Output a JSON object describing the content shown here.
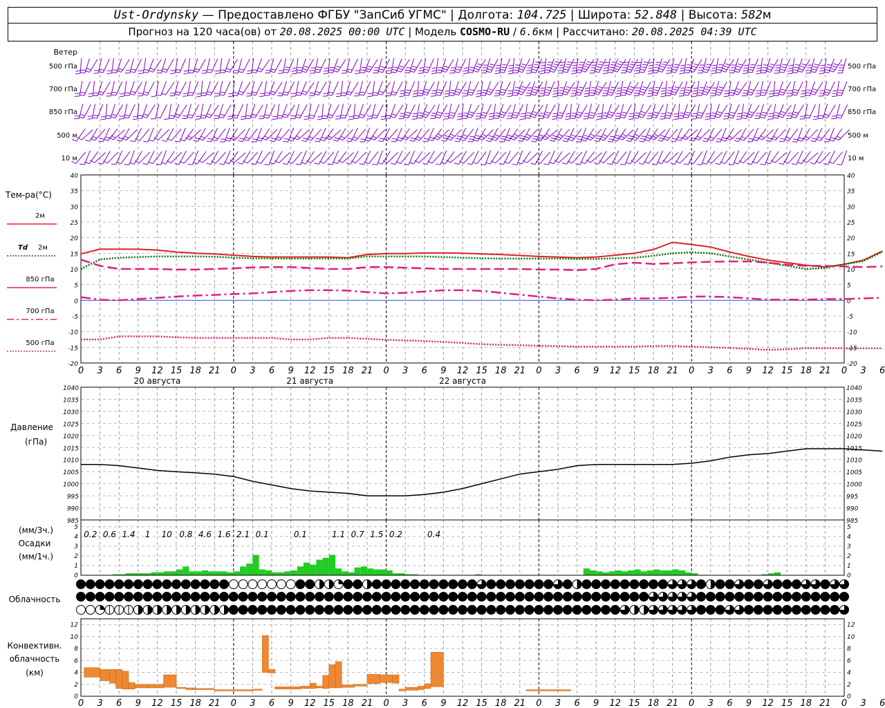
{
  "header": {
    "station": "Ust-Ordynsky",
    "provider": "Предоставлено ФГБУ \"ЗапСиб УГМС\"",
    "lon_label": "Долгота:",
    "lon": "104.725",
    "lat_label": "Широта:",
    "lat": "52.848",
    "alt_label": "Высота:",
    "alt": "582",
    "alt_unit": "м",
    "forecast_prefix": "Прогноз на 120 часа(ов) от",
    "forecast_from": "20.08.2025 00:00 UTC",
    "model_label": "Модель",
    "model": "COSMO-RU",
    "model_res": "6.6",
    "model_res_unit": "км",
    "calc_label": "Рассчитано:",
    "calc_time": "20.08.2025 04:39 UTC"
  },
  "chart_data": [
    {
      "id": "wind",
      "type": "wind_barbs",
      "title": "Ветер",
      "levels": [
        "500 гПа",
        "700 гПа",
        "850 гПа",
        "500 м",
        "10  м"
      ],
      "barb_color": "#8000c0",
      "speed_ms": [
        [
          12,
          11,
          10,
          9,
          8,
          8,
          9,
          10,
          11,
          12,
          12,
          13,
          14,
          13,
          12,
          13,
          14,
          15,
          16,
          15,
          14,
          18,
          20,
          22,
          23,
          24,
          25,
          25,
          24,
          24,
          23,
          22,
          22,
          22,
          22,
          22,
          22,
          22,
          22,
          22,
          20,
          18,
          16
        ],
        [
          8,
          9,
          9,
          8,
          7,
          8,
          9,
          10,
          11,
          12,
          12,
          11,
          10,
          10,
          10,
          11,
          12,
          13,
          14,
          15,
          15,
          16,
          17,
          18,
          19,
          20,
          20,
          20,
          20,
          19,
          19,
          18,
          18,
          18,
          17,
          16,
          15,
          14,
          14,
          14,
          13,
          12,
          12
        ],
        [
          8,
          9,
          9,
          8,
          7,
          8,
          9,
          10,
          10,
          11,
          11,
          10,
          10,
          10,
          11,
          12,
          12,
          13,
          13,
          14,
          14,
          15,
          16,
          16,
          17,
          17,
          17,
          16,
          16,
          15,
          15,
          15,
          15,
          14,
          14,
          14,
          13,
          13,
          12,
          12,
          12,
          11,
          11
        ],
        [
          7,
          8,
          8,
          7,
          7,
          7,
          8,
          9,
          10,
          10,
          10,
          10,
          10,
          10,
          11,
          11,
          12,
          12,
          12,
          13,
          13,
          14,
          14,
          14,
          15,
          15,
          14,
          14,
          14,
          13,
          13,
          12,
          12,
          12,
          12,
          11,
          11,
          11,
          10,
          10,
          10,
          9,
          9
        ],
        [
          3,
          3,
          3,
          3,
          3,
          3,
          3,
          4,
          5,
          5,
          5,
          4,
          4,
          4,
          5,
          5,
          5,
          5,
          5,
          5,
          5,
          5,
          5,
          5,
          5,
          5,
          5,
          5,
          4,
          4,
          4,
          4,
          4,
          3,
          3,
          3,
          3,
          3,
          3,
          3,
          3,
          3,
          3
        ]
      ]
    },
    {
      "id": "temperature",
      "type": "line",
      "ylabel": "Тем-ра(°C)",
      "ylim": [
        -20,
        40
      ],
      "x_hours_step": 3,
      "series": [
        {
          "name": "2м",
          "style": "solid",
          "color": "#e02020",
          "values": [
            14.8,
            16.3,
            16.3,
            16.3,
            16.0,
            15.4,
            15.0,
            14.8,
            14.4,
            14.0,
            13.8,
            13.8,
            13.8,
            13.8,
            13.6,
            14.6,
            14.9,
            14.9,
            15.1,
            15.1,
            15.0,
            14.8,
            14.6,
            14.3,
            14.0,
            13.8,
            13.6,
            13.8,
            14.4,
            15.0,
            16.2,
            18.5,
            17.8,
            17.0,
            15.4,
            14.0,
            12.8,
            12.0,
            11.2,
            10.6,
            11.5,
            12.8,
            15.7
          ]
        },
        {
          "name": "Td 2м",
          "style": "dotted",
          "color": "#007000",
          "values": [
            10.0,
            13.0,
            13.6,
            13.8,
            14.0,
            14.0,
            14.0,
            13.9,
            13.6,
            13.4,
            13.3,
            13.3,
            13.3,
            13.3,
            13.3,
            14.0,
            14.0,
            14.0,
            14.0,
            13.8,
            13.6,
            13.4,
            13.3,
            13.3,
            13.3,
            13.3,
            13.2,
            13.2,
            13.4,
            13.6,
            14.2,
            15.0,
            15.3,
            15.0,
            14.0,
            13.0,
            12.0,
            11.0,
            10.0,
            10.3,
            11.5,
            12.5,
            15.4
          ]
        },
        {
          "name": "850 гПа",
          "style": "dashed",
          "color": "#e0207a",
          "values": [
            13.0,
            11.0,
            10.0,
            10.0,
            10.0,
            9.8,
            9.8,
            10.0,
            10.2,
            10.5,
            10.6,
            10.6,
            10.3,
            10.0,
            10.0,
            10.6,
            10.6,
            10.4,
            10.2,
            10.0,
            10.0,
            10.0,
            10.0,
            10.0,
            9.8,
            9.8,
            9.6,
            10.0,
            11.5,
            12.0,
            11.6,
            11.8,
            12.1,
            12.3,
            12.4,
            12.4,
            12.0,
            11.4,
            11.0,
            11.0,
            10.8,
            10.6,
            10.8
          ]
        },
        {
          "name": "700 гПа",
          "style": "dashdot",
          "color": "#e0207a",
          "values": [
            1.0,
            0.2,
            0.0,
            0.4,
            0.8,
            1.2,
            1.5,
            1.7,
            2.0,
            2.2,
            2.6,
            3.0,
            3.2,
            3.2,
            3.1,
            2.6,
            2.2,
            2.4,
            2.8,
            3.2,
            3.2,
            3.0,
            2.4,
            1.8,
            1.2,
            0.6,
            0.2,
            0.0,
            0.2,
            0.6,
            0.6,
            0.8,
            1.2,
            1.2,
            1.0,
            0.6,
            0.2,
            0.2,
            0.2,
            0.4,
            0.4,
            0.6,
            0.8
          ]
        },
        {
          "name": "500 гПа",
          "style": "dotted",
          "color": "#e0207a",
          "values": [
            -12.5,
            -12.5,
            -11.5,
            -11.5,
            -11.5,
            -11.8,
            -12.0,
            -12.0,
            -12.0,
            -12.0,
            -12.0,
            -12.5,
            -12.5,
            -12.0,
            -12.0,
            -12.3,
            -12.6,
            -12.8,
            -13.0,
            -13.3,
            -13.6,
            -14.0,
            -14.2,
            -14.3,
            -14.5,
            -14.6,
            -14.8,
            -14.8,
            -14.8,
            -14.8,
            -14.6,
            -14.6,
            -14.8,
            -15.0,
            -15.2,
            -15.5,
            -15.8,
            -15.6,
            -15.3,
            -15.3,
            -15.3,
            -15.3,
            -15.3
          ]
        }
      ]
    },
    {
      "id": "pressure",
      "type": "line",
      "ylabel": "Давление",
      "yunit": "(гПа)",
      "ylim": [
        985,
        1040
      ],
      "series": [
        {
          "name": "",
          "values": [
            1008.0,
            1008.0,
            1007.5,
            1006.5,
            1005.5,
            1005.0,
            1004.5,
            1004.0,
            1003.0,
            1001.0,
            999.5,
            998.0,
            997.0,
            996.5,
            996.0,
            995.0,
            995.0,
            995.0,
            995.5,
            996.5,
            998.0,
            1000.0,
            1002.0,
            1004.0,
            1005.0,
            1006.0,
            1007.5,
            1008.0,
            1008.0,
            1008.0,
            1008.0,
            1008.0,
            1008.5,
            1009.5,
            1011.0,
            1012.0,
            1012.5,
            1013.5,
            1014.5,
            1014.5,
            1014.5,
            1014.0,
            1013.5
          ]
        }
      ]
    },
    {
      "id": "precip",
      "type": "bar",
      "ylabel": "(мм/3ч.)",
      "title": "Осадки",
      "yunit2": "(мм/1ч.)",
      "ylim": [
        0,
        5
      ],
      "bar_color": "#22cc22",
      "hourly_mm": [
        0,
        0,
        0,
        0,
        0,
        0.1,
        0.1,
        0.2,
        0.2,
        0.2,
        0.2,
        0.3,
        0.3,
        0.4,
        0.4,
        0.6,
        0.9,
        0.4,
        0.4,
        0.5,
        0.4,
        0.4,
        0.4,
        0.3,
        0.4,
        0.9,
        1.2,
        2.1,
        0.6,
        0.5,
        0.3,
        0.3,
        0.4,
        0.5,
        0.9,
        1.3,
        1.1,
        1.6,
        1.8,
        2.1,
        0.7,
        0.4,
        0.3,
        0.8,
        0.9,
        0.7,
        0.6,
        0.6,
        0.5,
        0.2,
        0.2,
        0.1,
        0.1,
        0,
        0,
        0,
        0,
        0,
        0,
        0,
        0,
        0,
        0.1,
        0,
        0,
        0,
        0,
        0,
        0,
        0,
        0,
        0,
        0,
        0,
        0,
        0,
        0,
        0,
        0,
        0.7,
        0.5,
        0.4,
        0.3,
        0.4,
        0.5,
        0.4,
        0.5,
        0.6,
        0.4,
        0.5,
        0.6,
        0.5,
        0.5,
        0.6,
        0.5,
        0.3,
        0.2,
        0,
        0,
        0,
        0,
        0,
        0,
        0,
        0,
        0,
        0,
        0.1,
        0.2,
        0.3,
        0,
        0,
        0,
        0,
        0,
        0,
        0,
        0,
        0,
        0,
        0
      ],
      "sums_3h": [
        {
          "hour": 1.5,
          "value": "0.2"
        },
        {
          "hour": 4.5,
          "value": "0.6"
        },
        {
          "hour": 7.5,
          "value": "1.4"
        },
        {
          "hour": 10.5,
          "value": "1"
        },
        {
          "hour": 13.5,
          "value": "10"
        },
        {
          "hour": 16.5,
          "value": "0.8"
        },
        {
          "hour": 19.5,
          "value": "4.6"
        },
        {
          "hour": 22.5,
          "value": "1.6"
        },
        {
          "hour": 25.5,
          "value": "2.1"
        },
        {
          "hour": 28.5,
          "value": "0.1"
        },
        {
          "hour": 34.5,
          "value": "0.1"
        },
        {
          "hour": 40.5,
          "value": "1.1"
        },
        {
          "hour": 43.5,
          "value": "0.7"
        },
        {
          "hour": 46.5,
          "value": "1.5"
        },
        {
          "hour": 49.5,
          "value": "0.2"
        },
        {
          "hour": 55.5,
          "value": "0.4"
        }
      ]
    },
    {
      "id": "clouds",
      "type": "cloud_symbols",
      "title": "Облачность",
      "rows": [
        "8888888888888888000000088442884888888888886888888868488888888866684886886888668666861800000000000000000000000000000000000000000000000",
        "8888888888888888888888888888888888888888888888888888888888886666688888888888888888888888888880004400800000000000000000000000000000000000",
        "0023334444444444888888888888888888888888888888888888888886446666688866888888888860000000000888888888888888888888888888888888888888888888"
      ]
    },
    {
      "id": "convective",
      "type": "bar",
      "title": "Конвективн. облачность",
      "yunit": "(км)",
      "ylim": [
        0,
        13
      ],
      "bar_color": "#ee8833",
      "bars": [
        {
          "from": 0.5,
          "to": 3,
          "bottom": 3.2,
          "top": 4.8
        },
        {
          "from": 3,
          "to": 4.5,
          "bottom": 2.6,
          "top": 4.5
        },
        {
          "from": 4.5,
          "to": 5.5,
          "bottom": 2.2,
          "top": 4.5
        },
        {
          "from": 5.5,
          "to": 6.5,
          "bottom": 1.3,
          "top": 4.5
        },
        {
          "from": 6.5,
          "to": 7.5,
          "bottom": 1.2,
          "top": 4.2
        },
        {
          "from": 7.5,
          "to": 8.5,
          "bottom": 1.2,
          "top": 2.3
        },
        {
          "from": 8.5,
          "to": 10.5,
          "bottom": 1.4,
          "top": 2.0
        },
        {
          "from": 10.5,
          "to": 13,
          "bottom": 1.4,
          "top": 2.0
        },
        {
          "from": 13,
          "to": 15,
          "bottom": 1.5,
          "top": 3.6
        },
        {
          "from": 15,
          "to": 16.5,
          "bottom": 1.3,
          "top": 1.5
        },
        {
          "from": 16.5,
          "to": 18,
          "bottom": 1.1,
          "top": 1.4
        },
        {
          "from": 18,
          "to": 21,
          "bottom": 1.1,
          "top": 1.3
        },
        {
          "from": 21,
          "to": 27,
          "bottom": 0.9,
          "top": 1.1
        },
        {
          "from": 27,
          "to": 28.5,
          "bottom": 1.0,
          "top": 1.2
        },
        {
          "from": 28.5,
          "to": 29.5,
          "bottom": 4.0,
          "top": 10.2
        },
        {
          "from": 29.5,
          "to": 30.5,
          "bottom": 3.9,
          "top": 4.5
        },
        {
          "from": 30.5,
          "to": 34.5,
          "bottom": 1.2,
          "top": 1.6
        },
        {
          "from": 34.5,
          "to": 36,
          "bottom": 1.3,
          "top": 1.7
        },
        {
          "from": 36,
          "to": 37,
          "bottom": 1.3,
          "top": 2.2
        },
        {
          "from": 37,
          "to": 38,
          "bottom": 1.4,
          "top": 1.7
        },
        {
          "from": 38,
          "to": 39,
          "bottom": 1.3,
          "top": 3.5
        },
        {
          "from": 39,
          "to": 40,
          "bottom": 1.4,
          "top": 5.3
        },
        {
          "from": 40,
          "to": 41,
          "bottom": 1.4,
          "top": 5.8
        },
        {
          "from": 41,
          "to": 43,
          "bottom": 1.5,
          "top": 1.9
        },
        {
          "from": 43,
          "to": 45,
          "bottom": 1.7,
          "top": 2.0
        },
        {
          "from": 45,
          "to": 47,
          "bottom": 2.1,
          "top": 3.7
        },
        {
          "from": 47,
          "to": 49,
          "bottom": 2.3,
          "top": 3.6
        },
        {
          "from": 49,
          "to": 50,
          "bottom": 2.2,
          "top": 3.6
        },
        {
          "from": 50,
          "to": 51,
          "bottom": 0.9,
          "top": 1.2
        },
        {
          "from": 51,
          "to": 53,
          "bottom": 1.0,
          "top": 1.5
        },
        {
          "from": 53,
          "to": 54,
          "bottom": 1.1,
          "top": 1.7
        },
        {
          "from": 54,
          "to": 55,
          "bottom": 1.3,
          "top": 2.1
        },
        {
          "from": 55,
          "to": 57,
          "bottom": 1.6,
          "top": 7.4
        },
        {
          "from": 70,
          "to": 77,
          "bottom": 0.9,
          "top": 1.1
        }
      ]
    }
  ],
  "x_axis": {
    "hours": 123,
    "tick_labels": [
      "0",
      "3",
      "6",
      "9",
      "12",
      "15",
      "18",
      "21",
      "0",
      "3",
      "6",
      "9",
      "12",
      "15",
      "18",
      "21",
      "0",
      "3",
      "6",
      "9",
      "12",
      "15",
      "18",
      "21",
      "0",
      "3",
      "6",
      "9",
      "12",
      "15",
      "18",
      "21",
      "0",
      "3",
      "6",
      "9",
      "12",
      "15",
      "18",
      "21",
      "0",
      "3",
      "6"
    ],
    "dates": [
      {
        "hour": 12,
        "label": "20 августа"
      },
      {
        "hour": 36,
        "label": "21 августа"
      },
      {
        "hour": 60,
        "label": "22 августа"
      }
    ]
  },
  "legend": {
    "t2m": "2м",
    "td_italic": "Td",
    "td_label": "2м",
    "t850": "850 гПа",
    "t700": "700 гПа",
    "t500": "500 гПа"
  }
}
